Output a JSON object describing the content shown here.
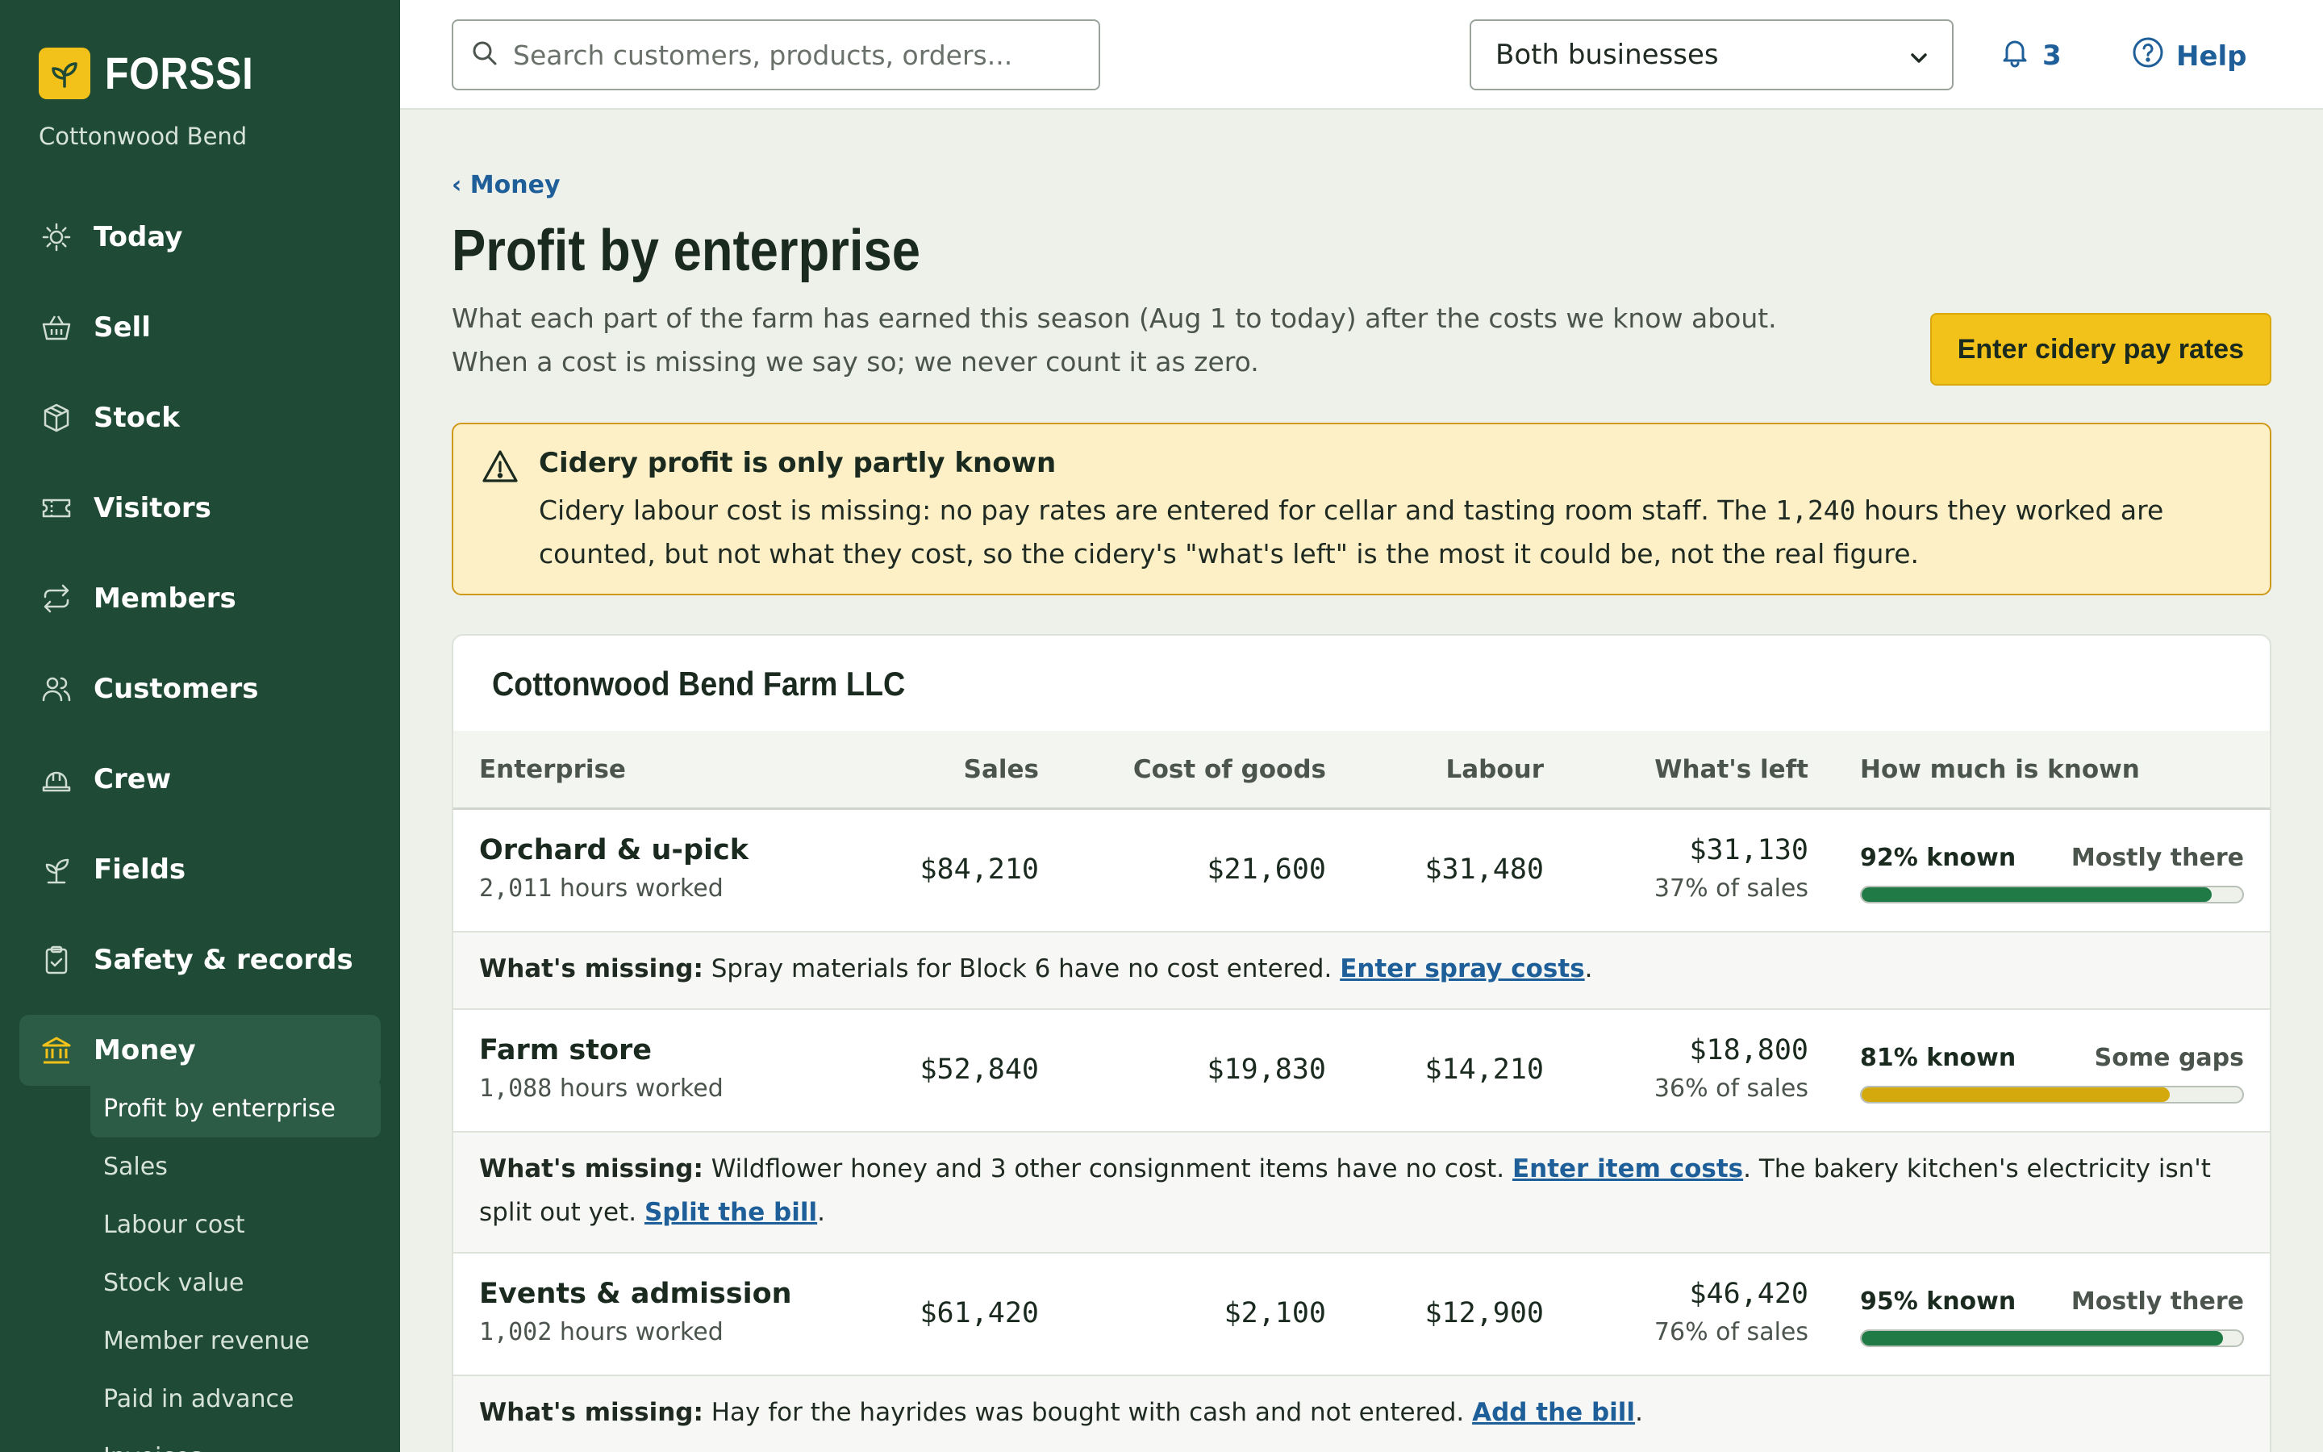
{
  "brand": {
    "name": "FORSSI",
    "farm": "Cottonwood Bend",
    "logo_color": "#f2c21b"
  },
  "sidebar": {
    "items": [
      {
        "label": "Today",
        "icon": "sun-icon"
      },
      {
        "label": "Sell",
        "icon": "basket-icon"
      },
      {
        "label": "Stock",
        "icon": "box-icon"
      },
      {
        "label": "Visitors",
        "icon": "ticket-icon"
      },
      {
        "label": "Members",
        "icon": "repeat-icon"
      },
      {
        "label": "Customers",
        "icon": "people-icon"
      },
      {
        "label": "Crew",
        "icon": "hardhat-icon"
      },
      {
        "label": "Fields",
        "icon": "sprout-icon"
      },
      {
        "label": "Safety & records",
        "icon": "clipboard-icon"
      },
      {
        "label": "Money",
        "icon": "bank-icon"
      }
    ],
    "sub_items": [
      {
        "label": "Profit by enterprise"
      },
      {
        "label": "Sales"
      },
      {
        "label": "Labour cost"
      },
      {
        "label": "Stock value"
      },
      {
        "label": "Member revenue"
      },
      {
        "label": "Paid in advance"
      },
      {
        "label": "Invoices"
      }
    ]
  },
  "topbar": {
    "search_placeholder": "Search customers, products, orders...",
    "business_select": "Both businesses",
    "notifications_count": "3",
    "help_label": "Help"
  },
  "page": {
    "breadcrumb": "‹ Money",
    "title": "Profit by enterprise",
    "intro": "What each part of the farm has earned this season (Aug 1 to today) after the costs we know about. When a cost is missing we say so; we never count it as zero.",
    "cta_label": "Enter cidery pay rates"
  },
  "alert": {
    "title": "Cidery profit is only partly known",
    "body_1": "Cidery labour cost is missing: no pay rates are entered for cellar and tasting room staff. The ",
    "hours": "1,240",
    "body_2": " hours they worked are counted, but not what they cost, so the cidery's \"what's left\" is the most it could be, not the real figure."
  },
  "card": {
    "title": "Cottonwood Bend Farm LLC",
    "columns": [
      "Enterprise",
      "Sales",
      "Cost of goods",
      "Labour",
      "What's left",
      "How much is known"
    ],
    "rows": [
      {
        "name": "Orchard & u-pick",
        "hours": "2,011",
        "hours_suffix": " hours worked",
        "sales": "$84,210",
        "cogs": "$21,600",
        "labour": "$31,480",
        "left": "$31,130",
        "left_pct": "37% of sales",
        "known": "92% known",
        "known_fraction": 0.92,
        "status": "Mostly there",
        "bar_color": "#1f7a45",
        "missing_label": "What's missing:",
        "missing_text": " Spray materials for Block 6 have no cost entered. ",
        "link_1": "Enter spray costs",
        "after_1": "."
      },
      {
        "name": "Farm store",
        "hours": "1,088",
        "hours_suffix": " hours worked",
        "sales": "$52,840",
        "cogs": "$19,830",
        "labour": "$14,210",
        "left": "$18,800",
        "left_pct": "36% of sales",
        "known": "81% known",
        "known_fraction": 0.81,
        "status": "Some gaps",
        "bar_color": "#d4a90e",
        "missing_label": "What's missing:",
        "missing_text": " Wildflower honey and 3 other consignment items have no cost. ",
        "link_1": "Enter item costs",
        "after_1": ". The bakery kitchen's electricity isn't split out yet. ",
        "link_2": "Split the bill",
        "after_2": "."
      },
      {
        "name": "Events & admission",
        "hours": "1,002",
        "hours_suffix": " hours worked",
        "sales": "$61,420",
        "cogs": "$2,100",
        "labour": "$12,900",
        "left": "$46,420",
        "left_pct": "76% of sales",
        "known": "95% known",
        "known_fraction": 0.95,
        "status": "Mostly there",
        "bar_color": "#1f7a45",
        "missing_label": "What's missing:",
        "missing_text": " Hay for the hayrides was bought with cash and not entered. ",
        "link_1": "Add the bill",
        "after_1": "."
      }
    ]
  }
}
